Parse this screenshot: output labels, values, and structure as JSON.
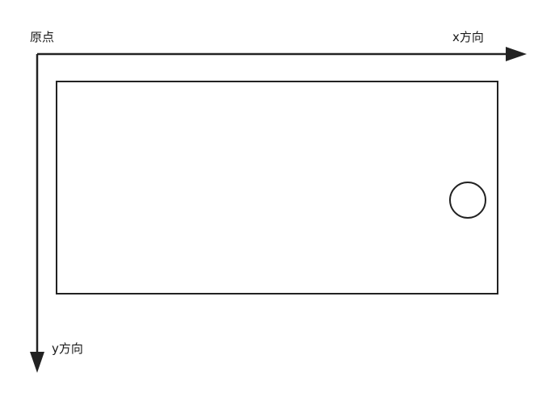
{
  "labels": {
    "origin": "原点",
    "x_direction": "x方向",
    "y_direction": "y方向"
  },
  "colors": {
    "stroke": "#222222",
    "text": "#1a1a1a",
    "background": "#ffffff"
  }
}
